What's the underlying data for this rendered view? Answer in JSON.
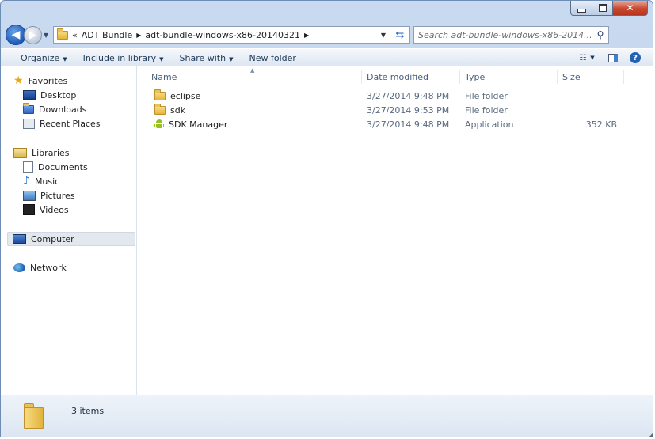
{
  "window": {
    "caption": {
      "minimize": "minimize-icon",
      "maximize": "maximize-icon",
      "close": "close-icon"
    }
  },
  "address": {
    "overflow": "«",
    "breadcrumbs": [
      "ADT Bundle",
      "adt-bundle-windows-x86-20140321"
    ],
    "search_placeholder": "Search adt-bundle-windows-x86-2014..."
  },
  "toolbar": {
    "organize": "Organize",
    "include_in_library": "Include in library",
    "share_with": "Share with",
    "new_folder": "New folder"
  },
  "nav_pane": {
    "favorites": {
      "label": "Favorites",
      "items": [
        "Desktop",
        "Downloads",
        "Recent Places"
      ]
    },
    "libraries": {
      "label": "Libraries",
      "items": [
        "Documents",
        "Music",
        "Pictures",
        "Videos"
      ]
    },
    "computer": "Computer",
    "network": "Network"
  },
  "file_list": {
    "columns": {
      "name": "Name",
      "date_modified": "Date modified",
      "type": "Type",
      "size": "Size"
    },
    "rows": [
      {
        "name": "eclipse",
        "date_modified": "3/27/2014 9:48 PM",
        "type": "File folder",
        "size": "",
        "icon": "folder-icon"
      },
      {
        "name": "sdk",
        "date_modified": "3/27/2014 9:53 PM",
        "type": "File folder",
        "size": "",
        "icon": "folder-icon"
      },
      {
        "name": "SDK Manager",
        "date_modified": "3/27/2014 9:48 PM",
        "type": "Application",
        "size": "352 KB",
        "icon": "android-icon"
      }
    ]
  },
  "status": {
    "items_count": "3 items"
  },
  "colors": {
    "accent": "#2461b4",
    "close_button": "#c8472f",
    "folder": "#e5b53a",
    "android": "#97c024"
  }
}
